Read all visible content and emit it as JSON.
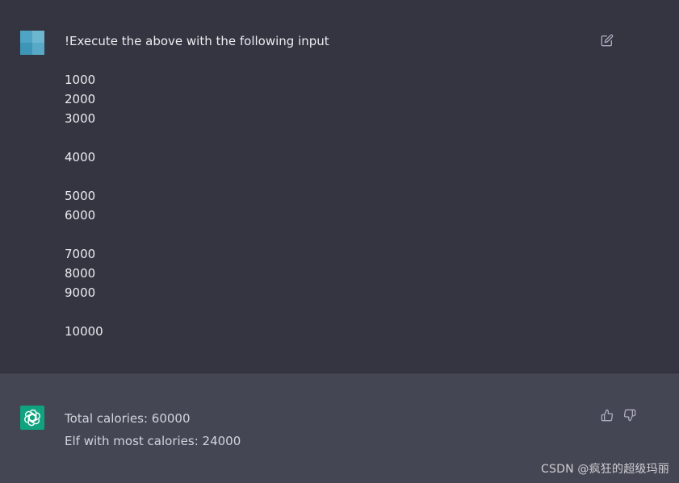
{
  "user_message": {
    "lines": [
      "!Execute the above with the following input",
      "",
      "1000",
      "2000",
      "3000",
      "",
      "4000",
      "",
      "5000",
      "6000",
      "",
      "7000",
      "8000",
      "9000",
      "",
      "10000"
    ]
  },
  "assistant_message": {
    "lines": [
      "Total calories: 60000",
      "Elf with most calories: 24000"
    ]
  },
  "watermark": "CSDN @疯狂的超级玛丽",
  "colors": {
    "user_bg": "#343541",
    "assistant_bg": "#444654",
    "brand_green": "#10a37f",
    "user_text": "#ececf1",
    "assistant_text": "#d1d5db"
  },
  "icons": {
    "edit": "edit-icon",
    "thumbs_up": "thumbs-up-icon",
    "thumbs_down": "thumbs-down-icon",
    "assistant_logo": "openai-logo-icon"
  }
}
